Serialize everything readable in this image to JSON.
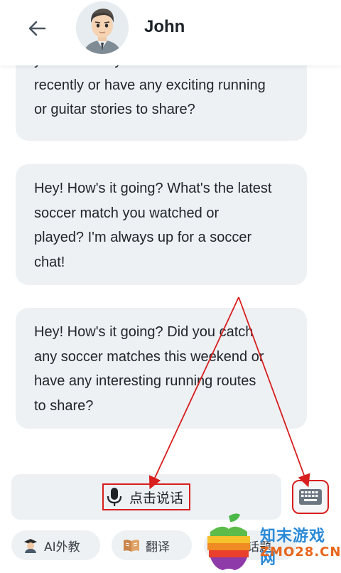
{
  "header": {
    "contact_name": "John",
    "back_icon": "arrow-left-icon",
    "avatar_icon": "avatar-illustration"
  },
  "messages": [
    {
      "id": "msg-1",
      "lines": [
        "you catch any soccer matches",
        "recently or have any exciting running",
        "or guitar stories to share?"
      ]
    },
    {
      "id": "msg-2",
      "lines": [
        "Hey! How's it going? What's the latest",
        "soccer match you watched or",
        "played? I'm always up for a soccer",
        "chat!"
      ]
    },
    {
      "id": "msg-3",
      "lines": [
        "Hey! How's it going? Did you catch",
        "any soccer matches this weekend or",
        "have any interesting running routes",
        "to share?"
      ]
    }
  ],
  "input_bar": {
    "voice_label": "点击说话",
    "voice_icon": "microphone-icon",
    "keyboard_icon": "keyboard-icon"
  },
  "quick_actions": [
    {
      "label": "AI外教",
      "icon": "teacher-icon"
    },
    {
      "label": "翻译",
      "icon": "book-icon"
    },
    {
      "label": "新话题",
      "icon": "topic-icon"
    }
  ],
  "watermark": {
    "text_cn": "知末游戏网",
    "text_en": "ZMO28.CN"
  },
  "colors": {
    "bubble_bg": "#edf1f4",
    "annotation_red": "#d81e1e",
    "watermark_blue": "#2a8ad8",
    "watermark_orange": "#e8651b"
  }
}
